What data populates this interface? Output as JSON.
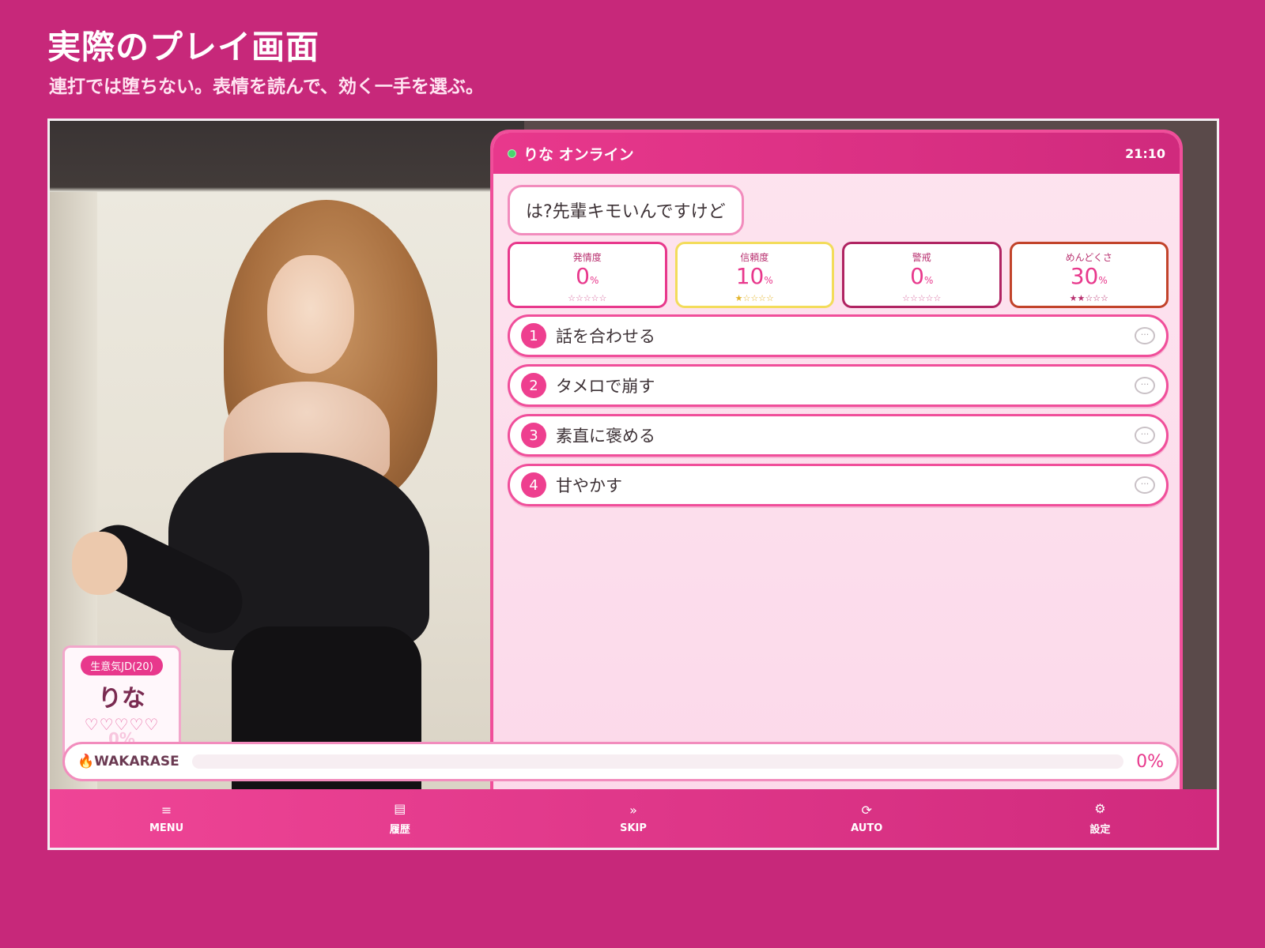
{
  "page": {
    "title": "実際のプレイ画面",
    "subtitle": "連打では堕ちない。表情を読んで、効く一手を選ぶ。"
  },
  "profile": {
    "tag": "生意気JD(20)",
    "name": "りな",
    "hearts": "♡♡♡♡♡",
    "percent": "0%"
  },
  "chat": {
    "name": "りな オンライン",
    "time": "21:10",
    "message": "は?先輩キモいんですけど"
  },
  "stats": [
    {
      "label": "発情度",
      "value": "0",
      "unit": "%",
      "stars": "☆☆☆☆☆",
      "level": 0
    },
    {
      "label": "信頼度",
      "value": "10",
      "unit": "%",
      "stars": "★☆☆☆☆",
      "level": 1
    },
    {
      "label": "警戒",
      "value": "0",
      "unit": "%",
      "stars": "☆☆☆☆☆",
      "level": 0
    },
    {
      "label": "めんどくさ",
      "value": "30",
      "unit": "%",
      "stars": "★★☆☆☆",
      "level": 2
    }
  ],
  "choices": [
    {
      "num": "1",
      "label": "話を合わせる",
      "icon": "speech-bubble-icon"
    },
    {
      "num": "2",
      "label": "タメロで崩す",
      "icon": "speech-bubble-icon"
    },
    {
      "num": "3",
      "label": "素直に褒める",
      "icon": "speech-bubble-icon"
    },
    {
      "num": "4",
      "label": "甘やかす",
      "icon": "speech-bubble-icon"
    }
  ],
  "progress": {
    "label": "🔥WAKARASE",
    "value": "0%",
    "fraction": 0
  },
  "nav": [
    {
      "icon": "≡",
      "label": "MENU"
    },
    {
      "icon": "▤",
      "label": "履歴"
    },
    {
      "icon": "»",
      "label": "SKIP"
    },
    {
      "icon": "⟳",
      "label": "AUTO"
    },
    {
      "icon": "⚙",
      "label": "設定"
    }
  ],
  "colors": {
    "background": "#c7287a",
    "accent": "#e8388c",
    "online": "#48d66e"
  }
}
